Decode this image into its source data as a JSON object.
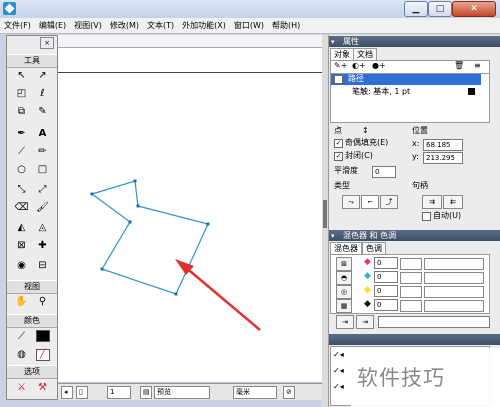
{
  "menu": [
    "文件(F)",
    "编辑(E)",
    "视图(V)",
    "修改(M)",
    "文本(T)",
    "外加功能(X)",
    "窗口(W)",
    "帮助(H)"
  ],
  "toolbox": {
    "tools_title": "工具",
    "view_title": "视图",
    "color_title": "颜色",
    "options_title": "选项"
  },
  "properties_panel": {
    "title": "属性",
    "tabs": [
      "对象",
      "文档"
    ],
    "list": {
      "selected": "路径",
      "stroke": "笔触: 基本, 1 pt"
    },
    "point_label": "点",
    "even_odd_label": "奇偶填充(E)",
    "closed_label": "封闭(C)",
    "smooth_label": "平滑度",
    "smooth_value": "0",
    "type_label": "类型",
    "position_label": "位置",
    "x_label": "x:",
    "x_value": "68.185",
    "y_label": "y:",
    "y_value": "213.295",
    "handle_label": "句柄",
    "auto_label": "自动(U)"
  },
  "mixer_panel": {
    "title": "混色器 和 色调",
    "tabs": [
      "混色器",
      "色调"
    ],
    "channels": [
      {
        "value": "0",
        "color": "#e0338a"
      },
      {
        "value": "0",
        "color": "#27b6c4"
      },
      {
        "value": "0",
        "color": "#f2e21b"
      },
      {
        "value": "0",
        "color": "#111111"
      }
    ]
  },
  "status": {
    "page": "1",
    "mode": "预览",
    "unit": "毫米"
  },
  "watermark": "软件技巧",
  "colors": {
    "accent": "#2e92c6",
    "arrow": "#e0322e",
    "panel_title": "#4a5a72"
  }
}
